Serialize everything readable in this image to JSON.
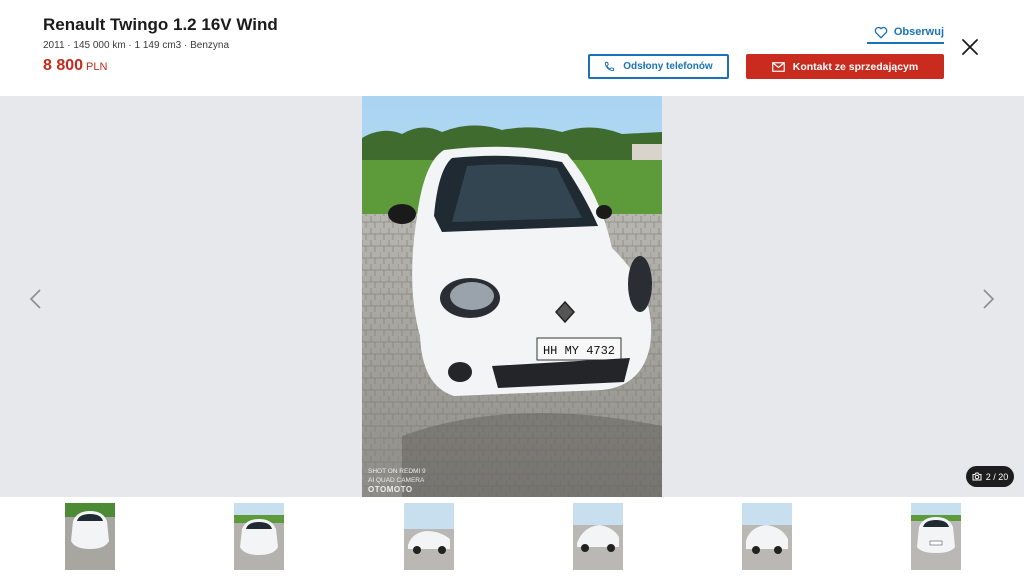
{
  "listing": {
    "title": "Renault Twingo 1.2 16V Wind",
    "subtitle": "2011 · 145 000 km · 1 149 cm3 · Benzyna",
    "price": "8 800",
    "currency": "PLN"
  },
  "actions": {
    "observe_label": "Obserwuj",
    "phone_label": "Odsłony telefonów",
    "contact_label": "Kontakt ze sprzedającym"
  },
  "gallery": {
    "counter": "2 / 20",
    "watermark_line1": "SHOT ON REDMI 9",
    "watermark_line2": "AI QUAD CAMERA",
    "watermark_brand": "OTOMOTO",
    "plate": "HH MY 4732"
  },
  "colors": {
    "accent_blue": "#1a73b8",
    "contact_red": "#c92b1f",
    "price_red": "#c42b1c",
    "gallery_bg": "#e7e8ec"
  },
  "icons": [
    "heart-icon",
    "close-icon",
    "phone-icon",
    "envelope-icon",
    "chevron-left-icon",
    "chevron-right-icon",
    "camera-icon"
  ]
}
